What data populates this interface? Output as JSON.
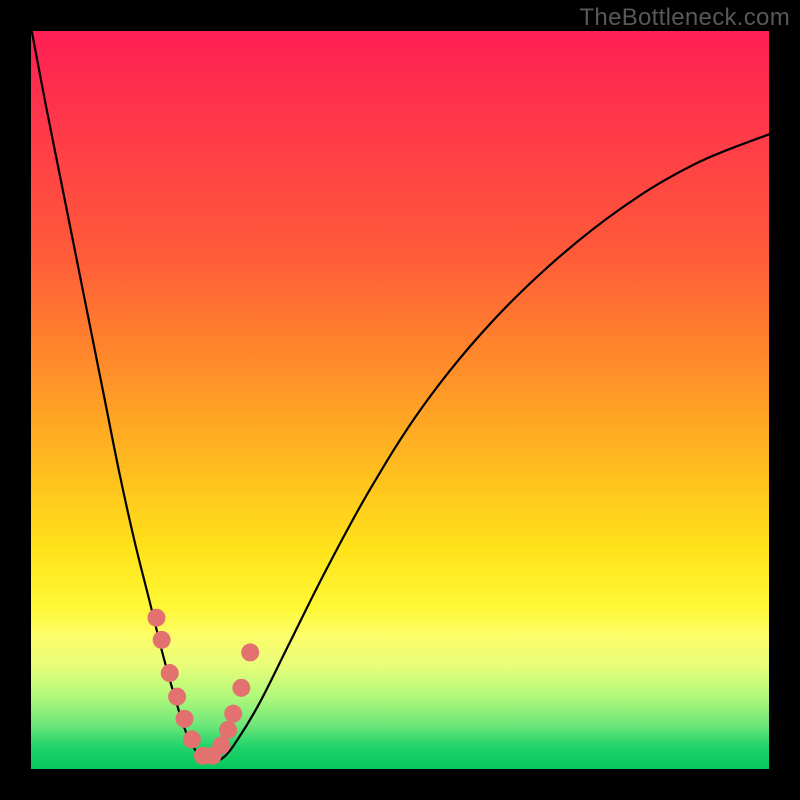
{
  "watermark": "TheBottleneck.com",
  "colors": {
    "frame": "#000000",
    "curve": "#000000",
    "marker": "#e2716f",
    "gradient_stops": [
      "#ff1f55",
      "#ff5a3a",
      "#ffb820",
      "#fff835",
      "#1fd36a"
    ]
  },
  "chart_data": {
    "type": "line",
    "title": "",
    "xlabel": "",
    "ylabel": "",
    "xlim": [
      0,
      100
    ],
    "ylim": [
      0,
      100
    ],
    "grid": false,
    "legend": false,
    "series": [
      {
        "name": "bottleneck-curve",
        "x": [
          0.1,
          2,
          4,
          6,
          8,
          10,
          12,
          14,
          16,
          18,
          20,
          21,
          22,
          23,
          24,
          26,
          28,
          31,
          35,
          40,
          46,
          53,
          61,
          70,
          80,
          90,
          100
        ],
        "y": [
          100,
          90,
          80,
          70,
          60,
          50,
          40,
          31,
          23,
          15,
          8,
          5,
          3,
          1.5,
          1,
          1.5,
          4,
          9,
          17,
          27,
          38,
          49,
          59,
          68,
          76,
          82,
          86
        ]
      }
    ],
    "markers": {
      "name": "highlighted-points",
      "x": [
        17.0,
        17.7,
        18.8,
        19.8,
        20.8,
        21.8,
        23.3,
        24.6,
        25.8,
        26.7,
        27.4,
        28.5,
        29.7
      ],
      "y": [
        20.5,
        17.5,
        13.0,
        9.8,
        6.8,
        4.0,
        1.8,
        1.8,
        3.2,
        5.3,
        7.5,
        11.0,
        15.8
      ]
    }
  }
}
